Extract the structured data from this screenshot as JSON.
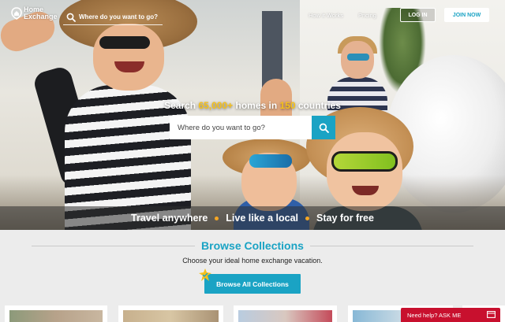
{
  "header": {
    "logo_line1": "Home",
    "logo_line2": "Exchange",
    "search_placeholder": "Where do you want to go?",
    "nav_how_it_works": "How it Works",
    "nav_pricing": "Pricing",
    "login_label": "LOG IN",
    "join_label": "JOIN NOW"
  },
  "hero": {
    "headline_prefix": "Search ",
    "homes_count": "65,000+",
    "headline_mid": " homes in ",
    "countries_count": "150",
    "headline_suffix": " countries",
    "search_placeholder": "Where do you want to go?",
    "taglines": [
      "Travel anywhere",
      "Live like a local",
      "Stay for free"
    ]
  },
  "browse": {
    "title": "Browse Collections",
    "subtitle": "Choose your ideal home exchange vacation.",
    "button_label": "Browse All Collections"
  },
  "help": {
    "label": "Need help? ASK ME"
  },
  "colors": {
    "accent": "#1aa3c4",
    "highlight": "#f5c01a",
    "tag_dot": "#f5a623",
    "help_red": "#c8102e"
  },
  "icons": [
    "home-exchange-logo-icon",
    "search-icon",
    "sparkle-badge-icon",
    "chat-icon"
  ]
}
